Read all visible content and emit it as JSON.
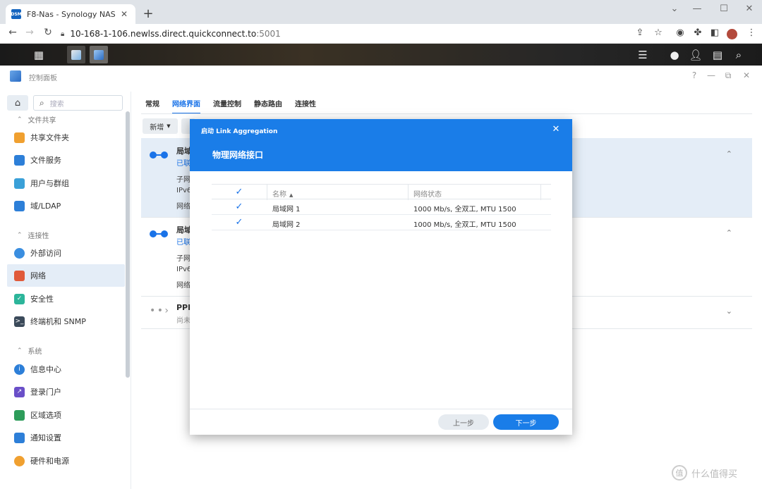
{
  "browser": {
    "tab_title": "F8-Nas - Synology NAS",
    "tab_favicon": "DSM",
    "url_main": "10-168-1-106.newlss.direct.quickconnect.to",
    "url_port": ":5001"
  },
  "window": {
    "title": "控制面板"
  },
  "sidebar": {
    "search_placeholder": "搜索",
    "sections": [
      {
        "label": "文件共享"
      },
      {
        "label": "连接性"
      },
      {
        "label": "系统"
      }
    ],
    "items": [
      {
        "label": "共享文件夹",
        "color": "#f0a030"
      },
      {
        "label": "文件服务",
        "color": "#2d7fd8"
      },
      {
        "label": "用户与群组",
        "color": "#3aa0d8"
      },
      {
        "label": "域/LDAP",
        "color": "#2d7fd8"
      },
      {
        "label": "外部访问",
        "color": "#3a8ee0"
      },
      {
        "label": "网络",
        "color": "#e05a3a"
      },
      {
        "label": "安全性",
        "color": "#2cb59a"
      },
      {
        "label": "终端机和 SNMP",
        "color": "#3b4a5a"
      },
      {
        "label": "信息中心",
        "color": "#2d7fd8"
      },
      {
        "label": "登录门户",
        "color": "#6a4fc8"
      },
      {
        "label": "区域选项",
        "color": "#2d9c5a"
      },
      {
        "label": "通知设置",
        "color": "#2d7fd8"
      },
      {
        "label": "硬件和电源",
        "color": "#f0a030"
      }
    ]
  },
  "main": {
    "tabs": [
      "常规",
      "网络界面",
      "流量控制",
      "静态路由",
      "连接性"
    ],
    "new_button": "新增",
    "interfaces": [
      {
        "name": "局域",
        "status": "已联",
        "lines": [
          "子网",
          "IPv6",
          "网络"
        ]
      },
      {
        "name": "局域",
        "status": "已联",
        "lines": [
          "子网",
          "IPv6",
          "网络"
        ]
      },
      {
        "name": "PPP",
        "status": "尚未"
      }
    ]
  },
  "modal": {
    "title": "启动 Link Aggregation",
    "heading": "物理网络接口",
    "columns": {
      "name": "名称",
      "status": "网络状态"
    },
    "rows": [
      {
        "name": "局域网 1",
        "status": "1000 Mb/s, 全双工, MTU 1500"
      },
      {
        "name": "局域网 2",
        "status": "1000 Mb/s, 全双工, MTU 1500"
      }
    ],
    "prev_button": "上一步",
    "next_button": "下一步"
  },
  "watermark": {
    "text": "什么值得买",
    "badge": "值"
  }
}
